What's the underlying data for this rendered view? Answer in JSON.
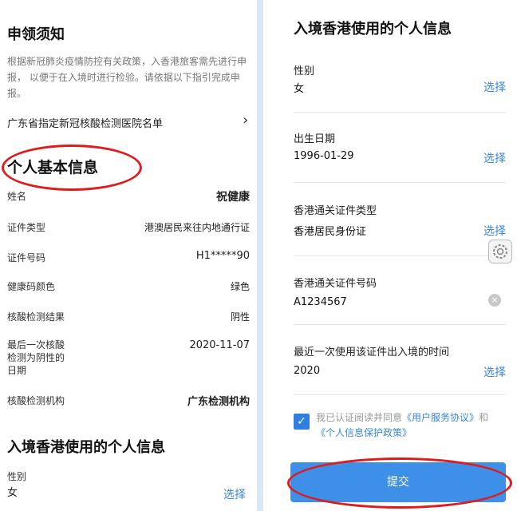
{
  "left": {
    "notice_title": "申领须知",
    "notice_text": "根据新冠肺炎疫情防控有关政策，入香港旅客需先进行申报， 以便于在入境时进行检验。请依据以下指引完成申报。",
    "hospital_list_label": "广东省指定新冠核酸检测医院名单",
    "hospital_list_chevron": "›",
    "basic_info_title": "个人基本信息",
    "rows": [
      {
        "label": "姓名",
        "value": "祝健康"
      },
      {
        "label": "证件类型",
        "value": "港澳居民来往内地通行证"
      },
      {
        "label": "证件号码",
        "value": "H1*****90"
      },
      {
        "label": "健康码颜色",
        "value": "绿色"
      },
      {
        "label": "核酸检测结果",
        "value": "阴性"
      },
      {
        "label": "最后一次核酸检测为阴性的日期",
        "value": "2020-11-07"
      },
      {
        "label": "核酸检测机构",
        "value": "广东检测机构"
      }
    ],
    "hk_section_title": "入境香港使用的个人信息",
    "gender_label": "性别",
    "gender_value": "女",
    "choose": "选择"
  },
  "right": {
    "title": "入境香港使用的个人信息",
    "fields": [
      {
        "label": "性别",
        "value": "女",
        "action": "选择"
      },
      {
        "label": "出生日期",
        "value": "1996-01-29",
        "action": "选择"
      },
      {
        "label": "香港通关证件类型",
        "value": "香港居民身份证",
        "action": "选择"
      },
      {
        "label": "香港通关证件号码",
        "value": "A1234567",
        "action": "×"
      },
      {
        "label": "最近一次使用该证件出入境的时间",
        "value": "2020",
        "action": "选择"
      }
    ],
    "agree_prefix": "我已认证阅读并同意",
    "agree_link1": "《用户服务协议》",
    "agree_mid": "和",
    "agree_link2": "《个人信息保护政策》",
    "check_mark": "✓",
    "submit_label": "提交"
  },
  "colors": {
    "accent": "#3b86d8",
    "annotation": "#e01b1b",
    "button": "#3d8fe8"
  }
}
